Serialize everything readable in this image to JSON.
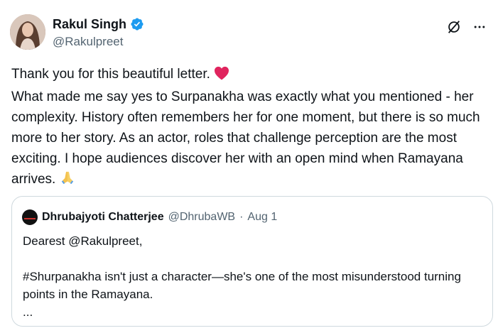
{
  "tweet": {
    "author": {
      "display_name": "Rakul Singh",
      "handle": "@Rakulpreet",
      "verified": true
    },
    "text": {
      "line1": "Thank you for this beautiful letter.",
      "line1_emoji": "❤️",
      "paragraph": "What made me say yes to Surpanakha was exactly what you mentioned - her complexity. History often remembers her for one moment, but there is so much more to her story. As an actor, roles that challenge perception are the most exciting. I hope audiences discover her with an open mind when Ramayana arrives.",
      "end_emoji": "🙏"
    },
    "header_icons": [
      "grok-icon",
      "more-options-icon"
    ]
  },
  "quoted_tweet": {
    "display_name": "Dhrubajyoti Chatterjee",
    "handle": "@DhrubaWB",
    "separator": "·",
    "date": "Aug 1",
    "greeting": "Dearest @Rakulpreet,",
    "body": "#Shurpanakha isn't just a character—she's one of the most misunderstood turning points in the Ramayana.",
    "ellipsis": "..."
  },
  "colors": {
    "verified_blue": "#1d9bf0",
    "heart_red": "#e0245e",
    "text_primary": "#0f1419",
    "text_secondary": "#536471",
    "border": "#cfd9de"
  }
}
